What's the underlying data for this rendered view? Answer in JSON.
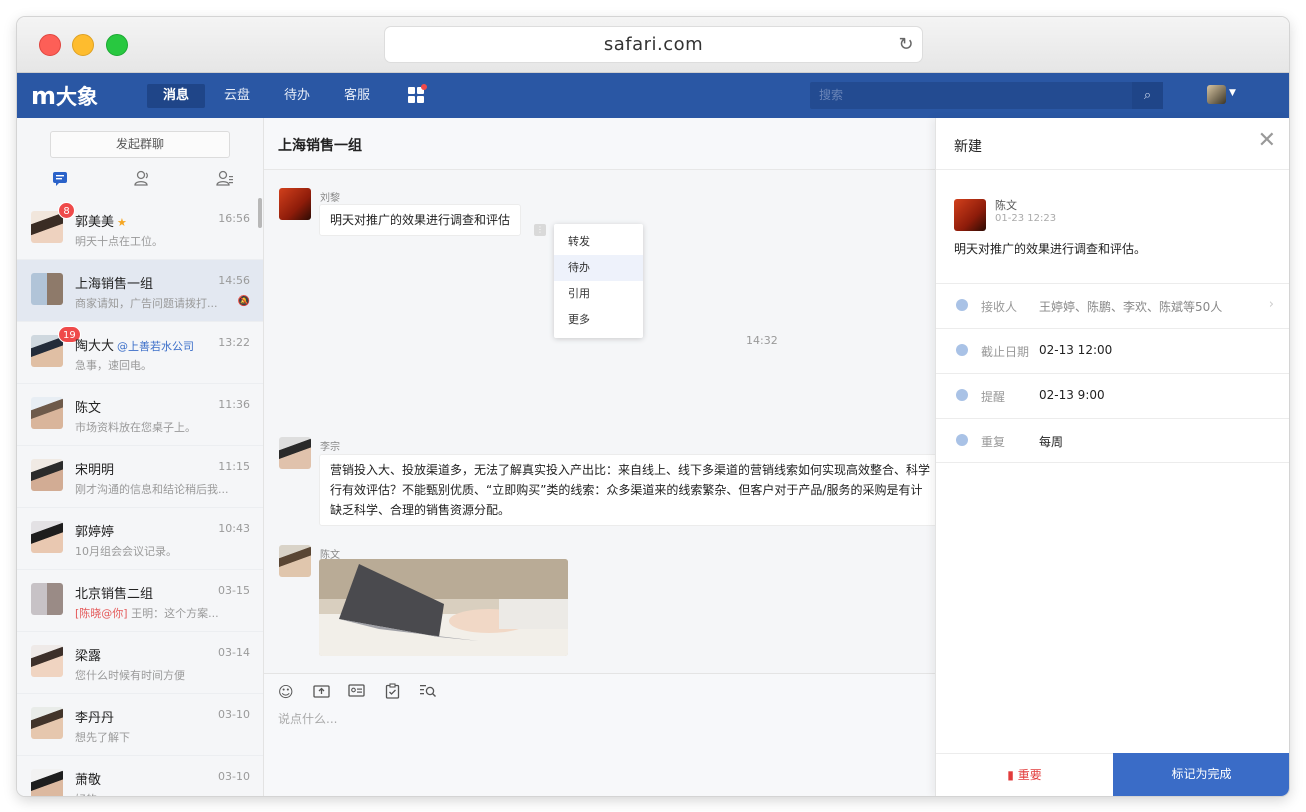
{
  "browser": {
    "url": "safari.com"
  },
  "topnav": {
    "logo_mark": "m",
    "logo_text": "大象",
    "tabs": [
      {
        "label": "消息"
      },
      {
        "label": "云盘"
      },
      {
        "label": "待办"
      },
      {
        "label": "客服"
      }
    ],
    "search_placeholder": "搜索",
    "accent": "#2a57a4"
  },
  "sidebar": {
    "start_group_label": "发起群聊",
    "conversations": [
      {
        "name": "郭美美",
        "time": "16:56",
        "preview": "明天十点在工位。",
        "badge": "8"
      },
      {
        "name": "上海销售一组",
        "time": "14:56",
        "preview": "商家请知，广告问题请拨打..."
      },
      {
        "name": "陶大大",
        "org": "@上善若水公司",
        "time": "13:22",
        "preview": "急事，速回电。",
        "badge": "19"
      },
      {
        "name": "陈文",
        "time": "11:36",
        "preview": "市场资料放在您桌子上。"
      },
      {
        "name": "宋明明",
        "time": "11:15",
        "preview": "刚才沟通的信息和结论稍后我..."
      },
      {
        "name": "郭婷婷",
        "time": "10:43",
        "preview": "10月组会会议记录。"
      },
      {
        "name": "北京销售二组",
        "time": "03-15",
        "mention": "[陈晓@你]",
        "preview": "王明：这个方案..."
      },
      {
        "name": "梁露",
        "time": "03-14",
        "preview": "您什么时候有时间方便"
      },
      {
        "name": "李丹丹",
        "time": "03-10",
        "preview": "想先了解下"
      },
      {
        "name": "萧敬",
        "time": "03-10",
        "preview": "好的"
      }
    ]
  },
  "chat": {
    "title": "上海销售一组",
    "messages": [
      {
        "sender": "刘黎",
        "text": "明天对推广的效果进行调查和评估"
      },
      {
        "sender": "李宗",
        "lines": [
          "营销投入大、投放渠道多，无法了解真实投入产出比：来自线上、线下多渠道的营销线索如何实现高效整合、科学",
          "行有效评估？不能甄别优质、“立即购买”类的线索：众多渠道来的线索繁杂、但客户对于产品/服务的采购是有计",
          "缺乏科学、合理的销售资源分配。"
        ]
      },
      {
        "sender": "陈文"
      }
    ],
    "time_separator": "14:32",
    "context_menu": [
      "转发",
      "待办",
      "引用",
      "更多"
    ],
    "composer_placeholder": "说点什么..."
  },
  "panel": {
    "title": "新建",
    "creator": "陈文",
    "created_at": "01-23 12:23",
    "content": "明天对推广的效果进行调查和评估。",
    "fields": [
      {
        "label": "接收人",
        "value": "王婷婷、陈鹏、李欢、陈斌等50人"
      },
      {
        "label": "截止日期",
        "value": "02-13 12:00"
      },
      {
        "label": "提醒",
        "value": "02-13 9:00"
      },
      {
        "label": "重复",
        "value": "每周"
      }
    ],
    "important_label": "重要",
    "done_label": "标记为完成",
    "done_color": "#3a6cc7"
  }
}
